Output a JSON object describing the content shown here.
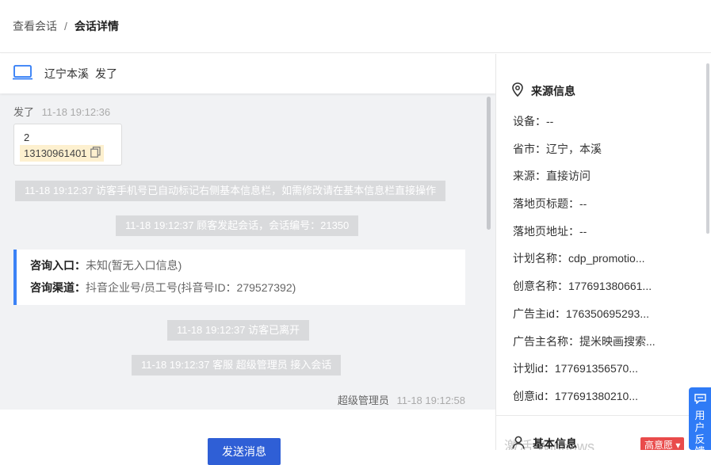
{
  "breadcrumb": {
    "parent": "查看会话",
    "separator": "/",
    "current": "会话详情"
  },
  "visitor": {
    "device_icon": "laptop-icon",
    "region": "辽宁本溪",
    "last_message": "发了"
  },
  "chat": {
    "visitor_message": {
      "text": "发了",
      "time": "11-18 19:12:36",
      "bubble_number": "2",
      "phone": "13130961401",
      "copy_icon": "copy-icon"
    },
    "system_notes": [
      "11-18 19:12:37 访客手机号已自动标记右侧基本信息栏，如需修改请在基本信息栏直接操作",
      "11-18 19:12:37 顾客发起会话，会话编号：21350"
    ],
    "source_card": {
      "entry_label": "咨询入口：",
      "entry_value": "未知(暂无入口信息)",
      "channel_label": "咨询渠道：",
      "channel_value": "抖音企业号/员工号(抖音号ID：279527392)"
    },
    "system_notes_2": [
      "11-18 19:12:37 访客已离开",
      "11-18 19:12:37 客服 超级管理员 接入会话"
    ],
    "agent_message": {
      "name": "超级管理员",
      "time": "11-18 19:12:58"
    }
  },
  "compose": {
    "send_label": "发送消息"
  },
  "source_info": {
    "title": "来源信息",
    "icon": "location-pin-icon",
    "rows": [
      "设备：--",
      "省市：辽宁，本溪",
      "来源：直接访问",
      "落地页标题：--",
      "落地页地址：--",
      "计划名称：cdp_promotio...",
      "创意名称：177691380661...",
      "广告主id：176350695293...",
      "广告主名称：提米映画搜索...",
      "计划id：177691356570...",
      "创意id：177691380210..."
    ]
  },
  "basic_info": {
    "title": "基本信息",
    "icon": "user-icon",
    "badge": "高意愿"
  },
  "watermark": "激活 Windows",
  "feedback": {
    "label": "用户反馈",
    "icon": "chat-icon"
  },
  "colors": {
    "primary": "#2f5fd6",
    "accent_blue": "#3b82f6",
    "badge_red": "#e94b4b",
    "phone_highlight": "#fdf0cf"
  }
}
